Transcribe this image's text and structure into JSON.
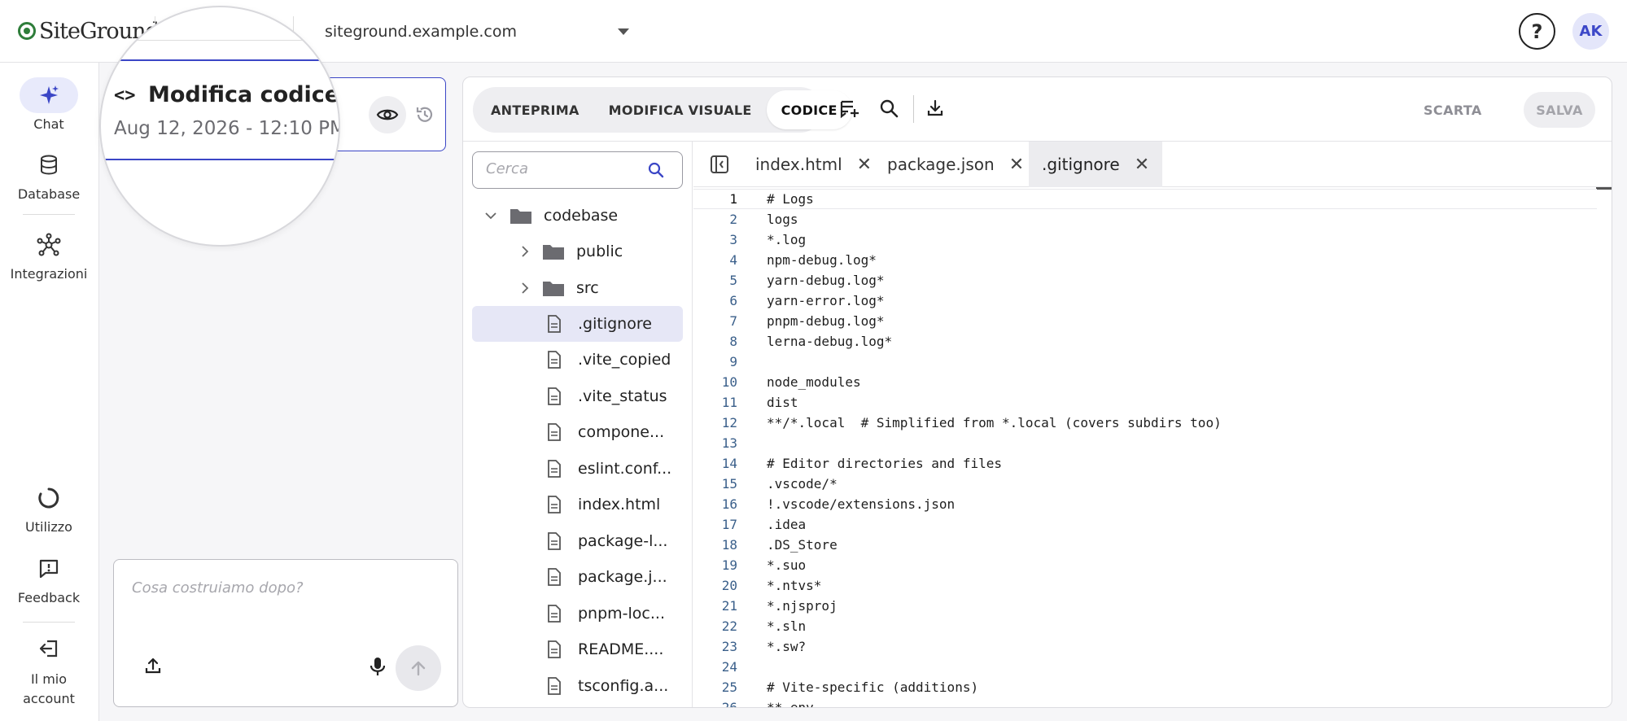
{
  "app": {
    "logo_text": "SiteGround",
    "site_domain": "siteground.example.com",
    "help_symbol": "?",
    "avatar_initials": "AK"
  },
  "rail": {
    "items": [
      {
        "label": "Chat",
        "icon": "sparkle-icon",
        "active": true
      },
      {
        "label": "Database",
        "icon": "database-icon"
      },
      {
        "label": "Integrazioni",
        "icon": "network-icon"
      },
      {
        "label": "Utilizzo",
        "icon": "usage-icon"
      },
      {
        "label": "Feedback",
        "icon": "feedback-icon"
      },
      {
        "label": "Il mio account",
        "icon": "logout-icon"
      }
    ]
  },
  "version_card": {
    "title": "Modifica codice",
    "date": "Aug 12, 2026 - 12:10 PM",
    "code_symbol": "<>"
  },
  "composer": {
    "placeholder": "Cosa costruiamo dopo?"
  },
  "toolbar": {
    "tabs": [
      "ANTEPRIMA",
      "MODIFICA VISUALE",
      "CODICE"
    ],
    "active_tab": "CODICE",
    "discard_label": "SCARTA",
    "save_label": "SALVA"
  },
  "tree": {
    "search_placeholder": "Cerca",
    "items": [
      {
        "label": "codebase",
        "type": "folder",
        "expanded": true
      },
      {
        "label": "public",
        "type": "folder"
      },
      {
        "label": "src",
        "type": "folder"
      },
      {
        "label": ".gitignore",
        "type": "file",
        "selected": true
      },
      {
        "label": ".vite_copied",
        "type": "file"
      },
      {
        "label": ".vite_status",
        "type": "file"
      },
      {
        "label": "compone...",
        "type": "file"
      },
      {
        "label": "eslint.conf...",
        "type": "file"
      },
      {
        "label": "index.html",
        "type": "file"
      },
      {
        "label": "package-l...",
        "type": "file"
      },
      {
        "label": "package.j...",
        "type": "file"
      },
      {
        "label": "pnpm-loc...",
        "type": "file"
      },
      {
        "label": "README....",
        "type": "file"
      },
      {
        "label": "tsconfig.a...",
        "type": "file"
      }
    ]
  },
  "editor_tabs": [
    {
      "label": "index.html",
      "active": false
    },
    {
      "label": "package.json",
      "active": false
    },
    {
      "label": ".gitignore",
      "active": true
    }
  ],
  "code_lines": [
    "# Logs",
    "logs",
    "*.log",
    "npm-debug.log*",
    "yarn-debug.log*",
    "yarn-error.log*",
    "pnpm-debug.log*",
    "lerna-debug.log*",
    "",
    "node_modules",
    "dist",
    "**/*.local  # Simplified from *.local (covers subdirs too)",
    "",
    "# Editor directories and files",
    ".vscode/*",
    "!.vscode/extensions.json",
    ".idea",
    ".DS_Store",
    "*.suo",
    "*.ntvs*",
    "*.njsproj",
    "*.sln",
    "*.sw?",
    "",
    "# Vite-specific (additions)",
    "**.env"
  ],
  "current_line": 1,
  "colors": {
    "accent": "#3b46c6",
    "brand_green": "#2e7d3a"
  }
}
